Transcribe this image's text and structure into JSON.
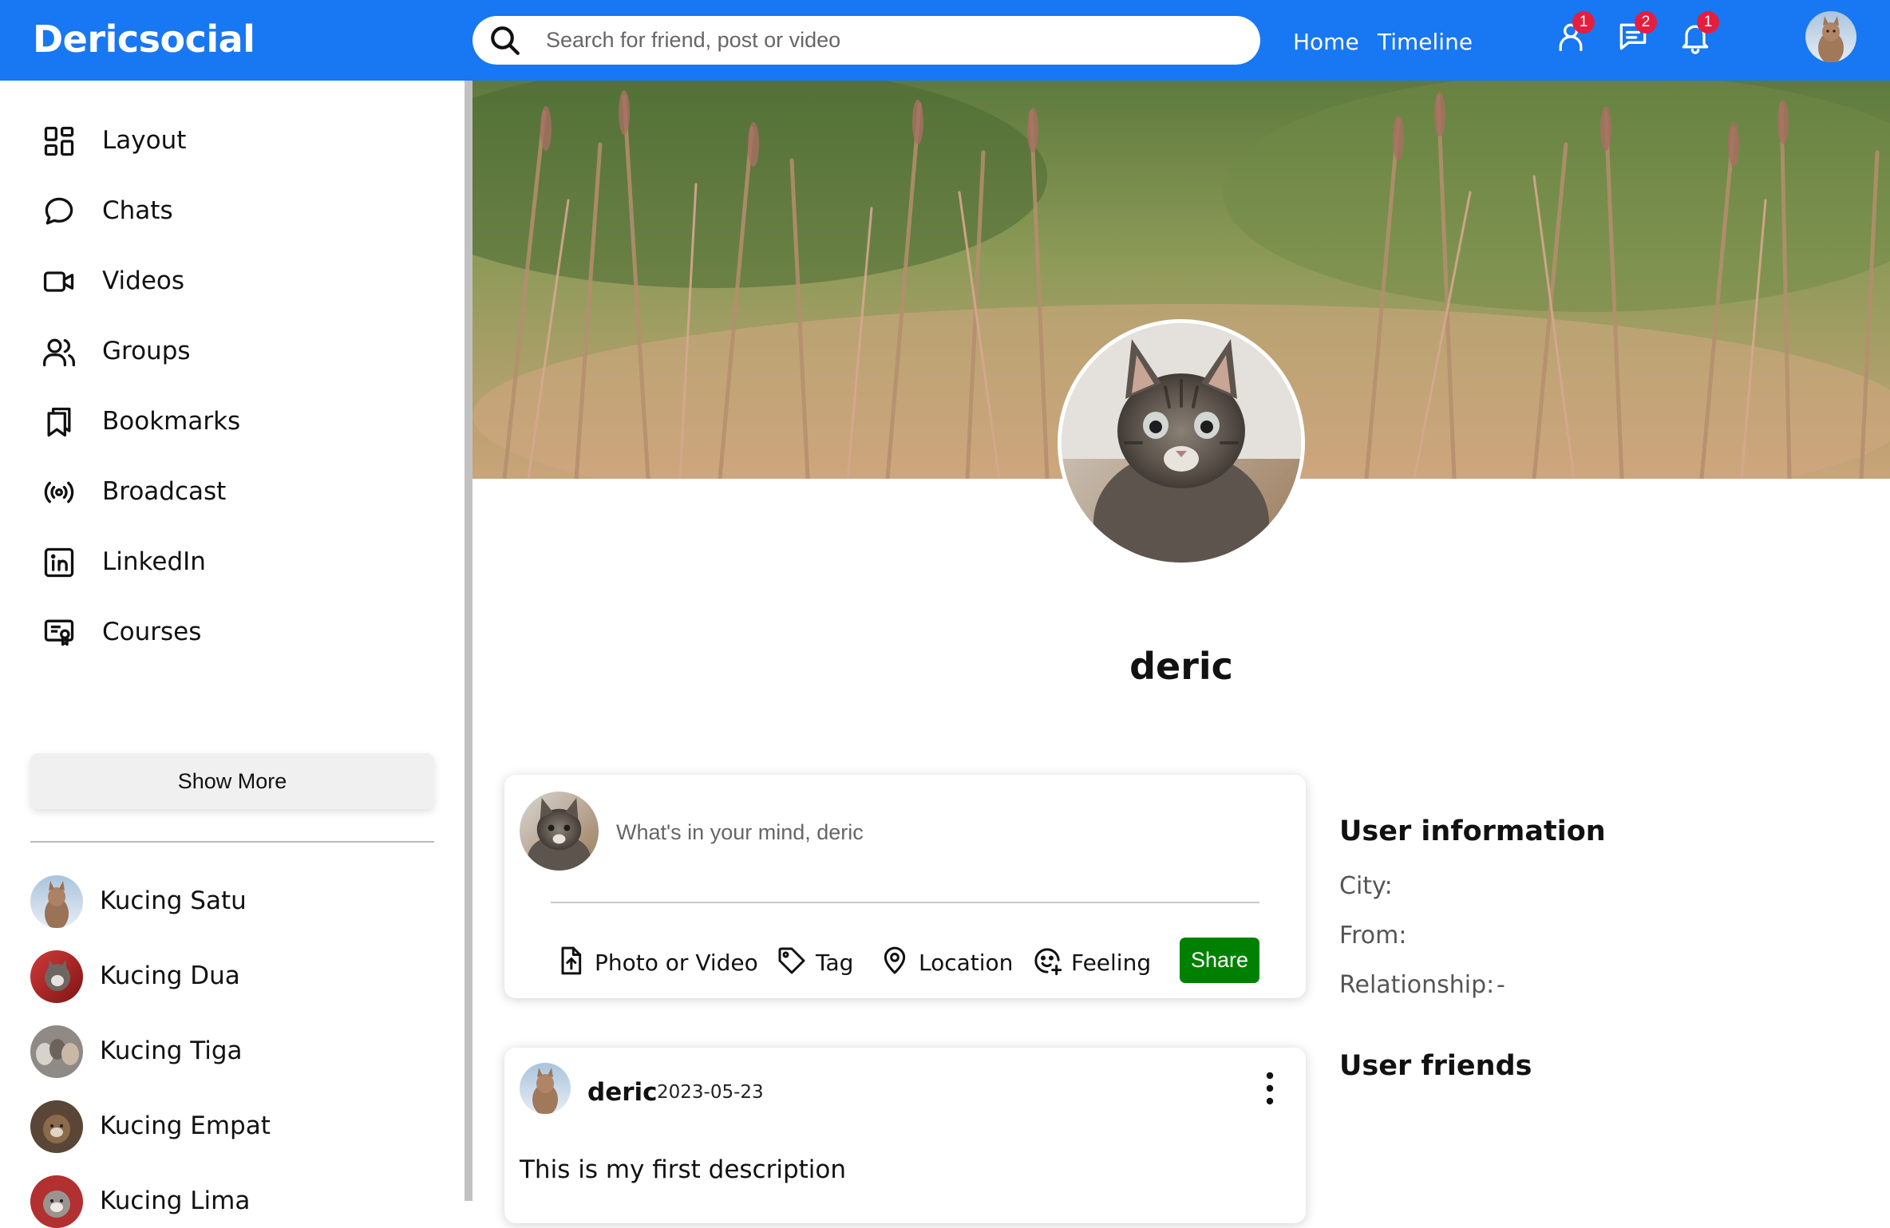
{
  "app": {
    "logo": "Dericsocial"
  },
  "search": {
    "placeholder": "Search for friend, post or video"
  },
  "nav": {
    "home": "Home",
    "timeline": "Timeline"
  },
  "notifications": {
    "friend_requests": "1",
    "messages": "2",
    "alerts": "1"
  },
  "sidebar": {
    "items": [
      {
        "label": "Layout",
        "icon": "layout-icon"
      },
      {
        "label": "Chats",
        "icon": "chat-icon"
      },
      {
        "label": "Videos",
        "icon": "video-icon"
      },
      {
        "label": "Groups",
        "icon": "groups-icon"
      },
      {
        "label": "Bookmarks",
        "icon": "bookmark-icon"
      },
      {
        "label": "Broadcast",
        "icon": "broadcast-icon"
      },
      {
        "label": "LinkedIn",
        "icon": "linkedin-icon"
      },
      {
        "label": "Courses",
        "icon": "courses-icon"
      }
    ],
    "show_more": "Show More",
    "friends": [
      "Kucing Satu",
      "Kucing Dua",
      "Kucing Tiga",
      "Kucing Empat",
      "Kucing Lima"
    ]
  },
  "profile": {
    "name": "deric"
  },
  "share": {
    "placeholder": "What's in your mind, deric",
    "options": [
      "Photo or Video",
      "Tag",
      "Location",
      "Feeling"
    ],
    "button": "Share"
  },
  "post": {
    "username": "deric",
    "date": "2023-05-23",
    "text": "This is my first description"
  },
  "user_info": {
    "title": "User information",
    "city_label": "City:",
    "city_value": "",
    "from_label": "From:",
    "from_value": "",
    "relationship_label": "Relationship:",
    "relationship_value": "-"
  },
  "user_friends": {
    "title": "User friends"
  },
  "colors": {
    "brand": "#1877f2",
    "share": "#008000",
    "badge": "#e41e3f"
  }
}
